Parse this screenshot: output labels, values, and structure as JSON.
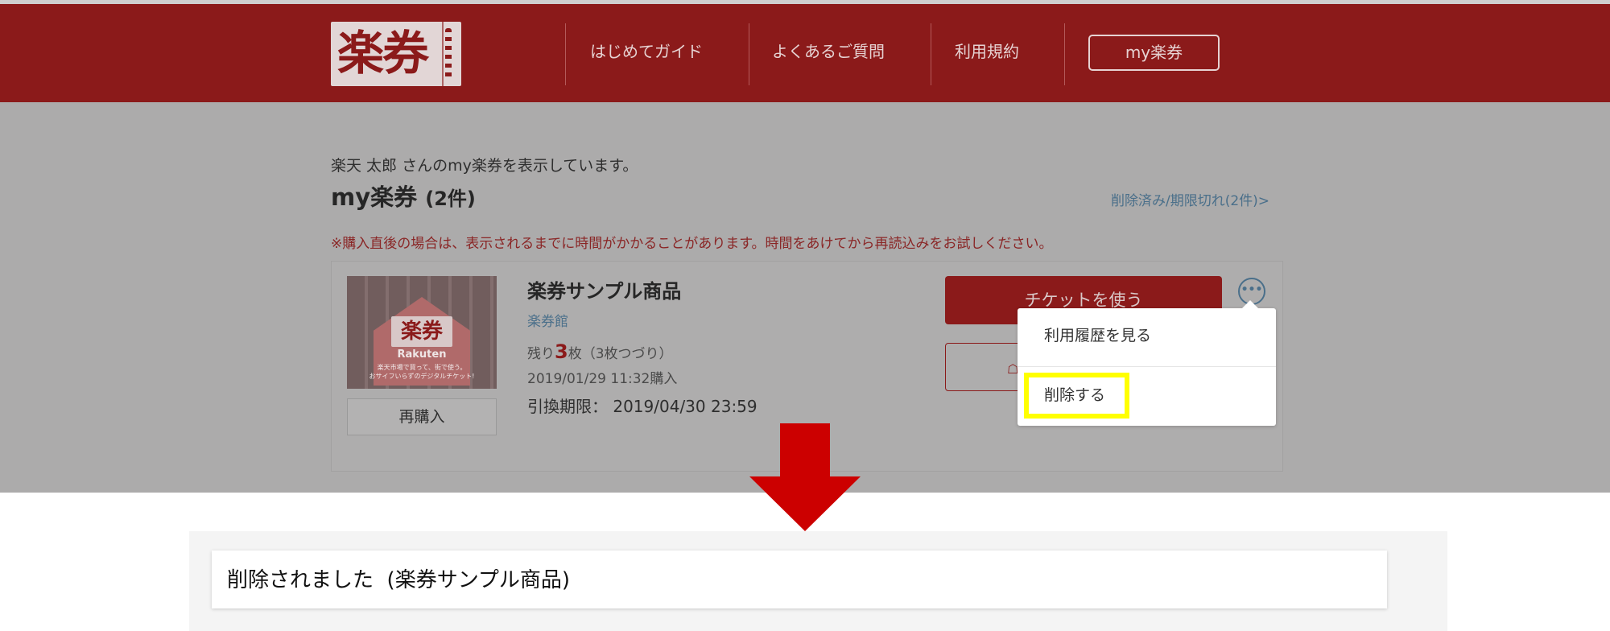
{
  "header": {
    "logo_text": "楽券",
    "nav": [
      "はじめてガイド",
      "よくあるご質問",
      "利用規約"
    ],
    "my_button": "my楽券"
  },
  "main": {
    "greeting": "楽天 太郎 さんのmy楽券を表示しています。",
    "title": "my楽券",
    "title_count": "(2件)",
    "expired_link": "削除済み/期限切れ(2件)>",
    "notice": "※購入直後の場合は、表示されるまでに時間がかかることがあります。時間をあけてから再読込みをお試しください。"
  },
  "ticket": {
    "thumbnail": {
      "logo_text": "楽券",
      "brand": "Rakuten",
      "tagline_1": "楽天市場で買って、街で使う。",
      "tagline_2": "おサイフいらずのデジタルチケット!"
    },
    "rebuy_label": "再購入",
    "name": "楽券サンプル商品",
    "store": "楽券館",
    "remaining_prefix": "残り",
    "remaining_count": "3",
    "remaining_suffix": "枚（3枚つづり）",
    "purchased": "2019/01/29 11:32購入",
    "expiry_label": "引換期限：",
    "expiry_value": "2019/04/30 23:59",
    "use_button": "チケットを使う",
    "more_icon": "ellipsis-icon"
  },
  "popup": {
    "history": "利用履歴を見る",
    "delete": "削除する",
    "highlight_color": "#ffff00"
  },
  "result": {
    "message": "削除されました",
    "item": "(楽券サンプル商品)"
  },
  "colors": {
    "brand_red": "#8b1a1a",
    "arrow_red": "#cc0000"
  }
}
